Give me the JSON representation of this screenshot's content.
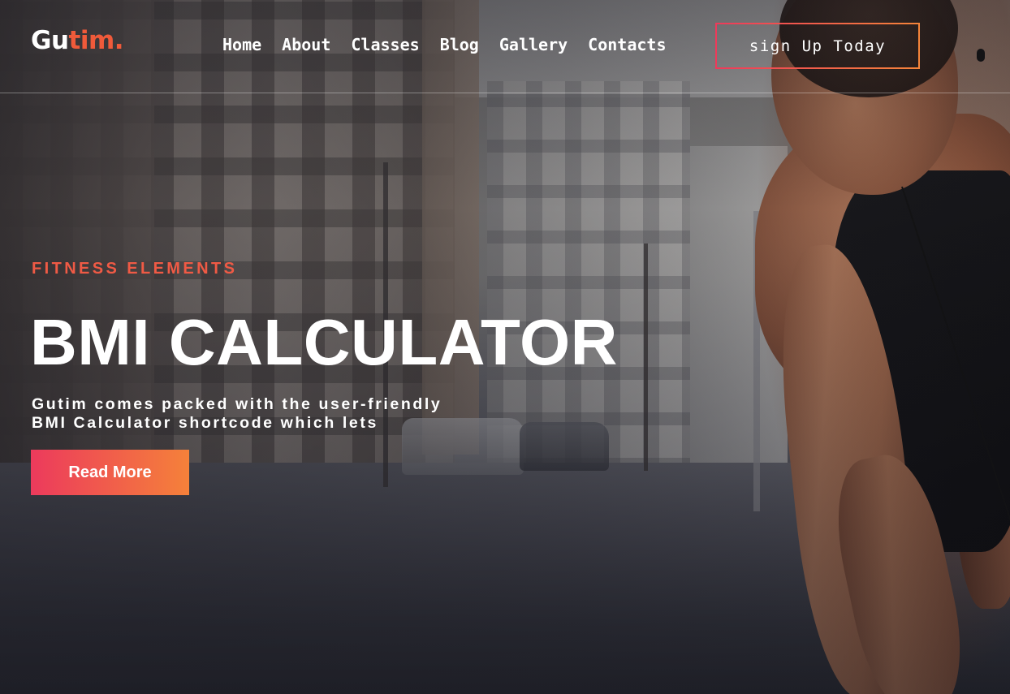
{
  "brand": {
    "logo_part1": "Gu",
    "logo_part2": "tim.",
    "accent_color": "#f05a3a",
    "button_gradient": [
      "#ec3a5c",
      "#f5813a"
    ]
  },
  "nav": {
    "items": [
      {
        "label": "Home"
      },
      {
        "label": "About"
      },
      {
        "label": "Classes"
      },
      {
        "label": "Blog"
      },
      {
        "label": "Gallery"
      },
      {
        "label": "Contacts"
      }
    ],
    "cta_label": "sign Up Today"
  },
  "hero": {
    "eyebrow": "FITNESS ELEMENTS",
    "title": "BMI CALCULATOR",
    "description_line1": "Gutim comes packed with the user-friendly",
    "description_line2": "BMI Calculator shortcode which lets",
    "button_label": "Read More",
    "background_icon": "runner-street-photo"
  }
}
